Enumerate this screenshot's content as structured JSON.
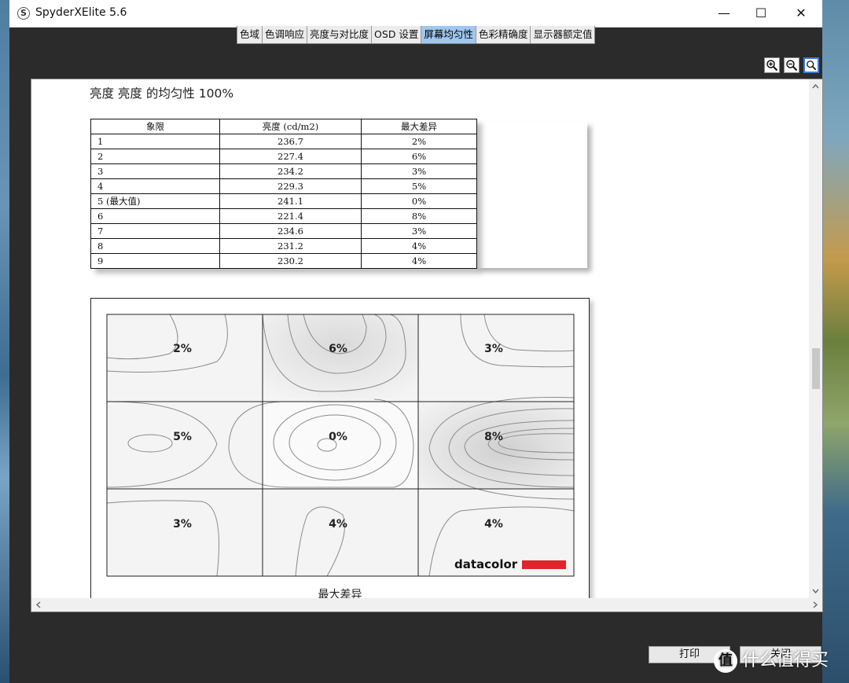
{
  "window": {
    "title": "SpyderXElite 5.6",
    "icon_letter": "S",
    "minimize": "—",
    "maximize": "☐",
    "close": "✕"
  },
  "tabs": [
    {
      "label": "色域",
      "active": false
    },
    {
      "label": "色调响应",
      "active": false
    },
    {
      "label": "亮度与对比度",
      "active": false
    },
    {
      "label": "OSD 设置",
      "active": false
    },
    {
      "label": "屏幕均匀性",
      "active": true
    },
    {
      "label": "色彩精确度",
      "active": false
    },
    {
      "label": "显示器额定值",
      "active": false
    }
  ],
  "zoom": {
    "zoom_in": "zoom-in-icon",
    "zoom_out": "zoom-out-icon",
    "zoom_fit": "zoom-fit-icon"
  },
  "report": {
    "title": "亮度 亮度 的均匀性 100%",
    "table": {
      "headers": [
        "象限",
        "亮度 (cd/m2)",
        "最大差异"
      ],
      "rows": [
        [
          "1",
          "236.7",
          "2%"
        ],
        [
          "2",
          "227.4",
          "6%"
        ],
        [
          "3",
          "234.2",
          "3%"
        ],
        [
          "4",
          "229.3",
          "5%"
        ],
        [
          "5 (最大值)",
          "241.1",
          "0%"
        ],
        [
          "6",
          "221.4",
          "8%"
        ],
        [
          "7",
          "234.6",
          "3%"
        ],
        [
          "8",
          "231.2",
          "4%"
        ],
        [
          "9",
          "230.2",
          "4%"
        ]
      ]
    },
    "chart": {
      "caption": "最大差异",
      "logo_text": "datacolor",
      "cells": [
        "2%",
        "6%",
        "3%",
        "5%",
        "0%",
        "8%",
        "3%",
        "4%",
        "4%"
      ]
    }
  },
  "buttons": {
    "print": "打印",
    "close": "关闭"
  },
  "watermark": {
    "glyph": "值",
    "text": "什么值得买"
  },
  "colors": {
    "active_tab": "#9fc7ef",
    "logo_red": "#e0242b"
  }
}
